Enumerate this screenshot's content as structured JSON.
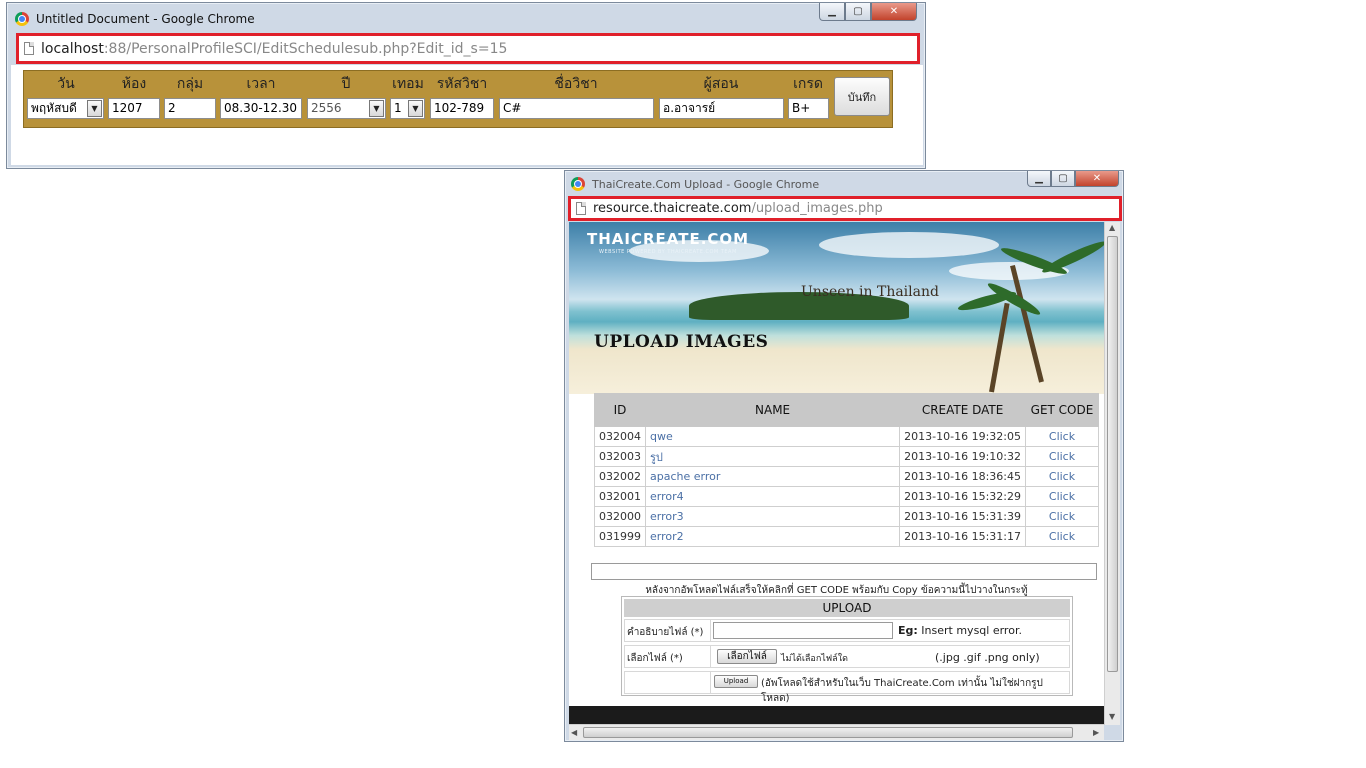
{
  "window1": {
    "title": "Untitled Document - Google Chrome",
    "url_host": "localhost",
    "url_rest": ":88/PersonalProfileSCI/EditSchedulesub.php?Edit_id_s=15",
    "schedule": {
      "headers": [
        "วัน",
        "ห้อง",
        "กลุ่ม",
        "เวลา",
        "ปี",
        "เทอม",
        "รหัสวิชา",
        "ชื่อวิชา",
        "ผู้สอน",
        "เกรด"
      ],
      "day": "พฤหัสบดี",
      "room": "1207",
      "group": "2",
      "time": "08.30-12.30",
      "year": "2556",
      "term": "1",
      "course_code": "102-789",
      "course_name": "C#",
      "teacher": "อ.อาจารย์",
      "grade": "B+",
      "save_label": "บันทึก"
    }
  },
  "window2": {
    "title": "ThaiCreate.Com Upload - Google Chrome",
    "url_host": "resource.thaicreate.com",
    "url_rest": "/upload_images.php",
    "banner": {
      "logo": "THAICREATE.COM",
      "logo_sub": "WEBSITE POWERED BY THAICREATE.COM TEAM",
      "tagline": "Unseen in Thailand",
      "heading": "UPLOAD IMAGES"
    },
    "table": {
      "headers": [
        "ID",
        "NAME",
        "CREATE DATE",
        "GET CODE"
      ],
      "rows": [
        {
          "id": "032004",
          "name": "qwe",
          "date": "2013-10-16 19:32:05",
          "action": "Click"
        },
        {
          "id": "032003",
          "name": "รูป",
          "date": "2013-10-16 19:10:32",
          "action": "Click"
        },
        {
          "id": "032002",
          "name": "apache error",
          "date": "2013-10-16 18:36:45",
          "action": "Click"
        },
        {
          "id": "032001",
          "name": "error4",
          "date": "2013-10-16 15:32:29",
          "action": "Click"
        },
        {
          "id": "032000",
          "name": "error3",
          "date": "2013-10-16 15:31:39",
          "action": "Click"
        },
        {
          "id": "031999",
          "name": "error2",
          "date": "2013-10-16 15:31:17",
          "action": "Click"
        }
      ]
    },
    "hint": "หลังจากอัพโหลดไฟล์เสร็จให้คลิกที่ GET CODE พร้อมกับ Copy ข้อความนี้ไปวางในกระทู้",
    "upload_form": {
      "header": "UPLOAD",
      "desc_label": "คำอธิบายไฟล์ (*)",
      "eg_label": "Eg:",
      "eg_value": "Insert mysql error.",
      "file_label": "เลือกไฟล์ (*)",
      "file_button": "เลือกไฟล์",
      "file_none": "ไม่ได้เลือกไฟล์ใด",
      "extensions": "(.jpg .gif .png only)",
      "upload_button": "Upload",
      "upload_note": "(อัพโหลดใช้สำหรับในเว็บ ThaiCreate.Com เท่านั้น ไม่ใช่ฝากรูปโหลด)"
    }
  }
}
